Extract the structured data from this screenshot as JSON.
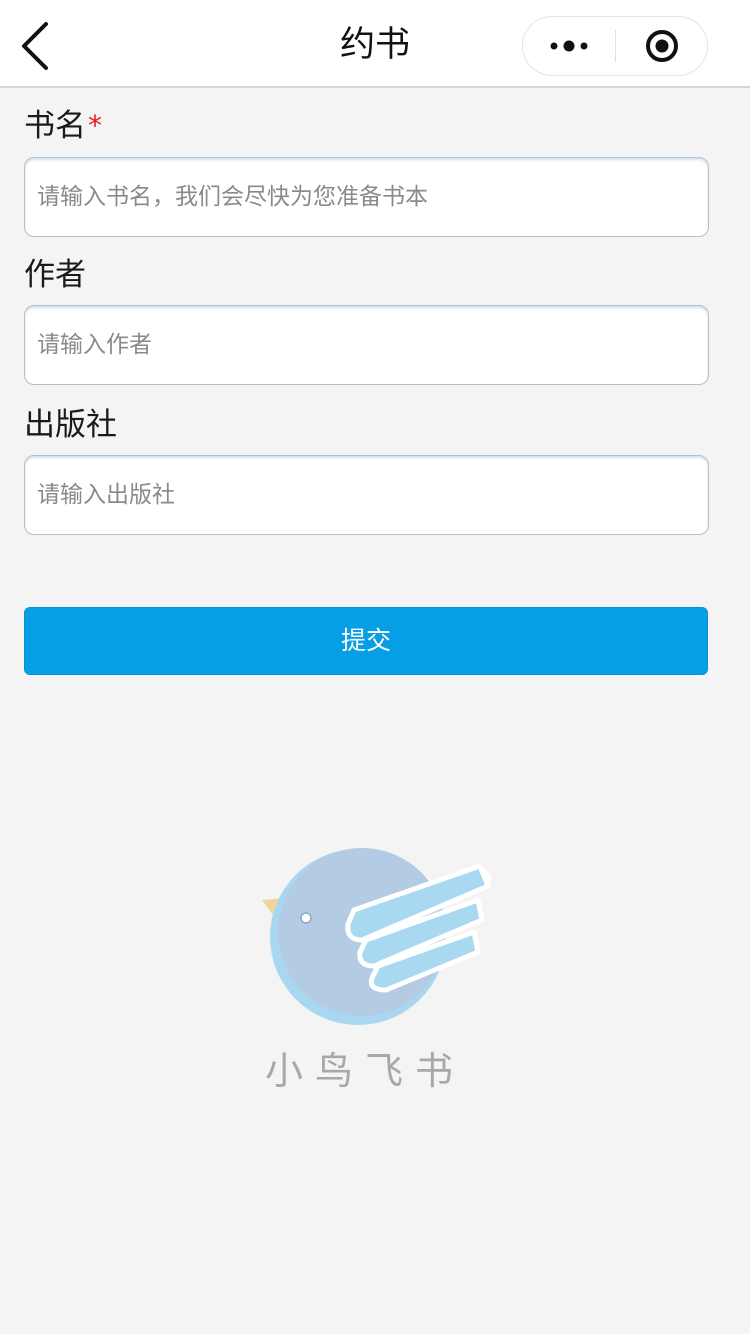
{
  "navbar": {
    "title": "约书"
  },
  "form": {
    "book_name": {
      "label": "书名",
      "required_mark": "*",
      "placeholder": "请输入书名，我们会尽快为您准备书本",
      "value": ""
    },
    "author": {
      "label": "作者",
      "placeholder": "请输入作者",
      "value": ""
    },
    "publisher": {
      "label": "出版社",
      "placeholder": "请输入出版社",
      "value": ""
    },
    "submit_label": "提交"
  },
  "brand": {
    "logo_icon": "bird-book-logo-icon",
    "logo_text": "小鸟飞书"
  },
  "colors": {
    "primary": "#069fe6",
    "required": "#e02020",
    "background": "#f4f4f4"
  }
}
